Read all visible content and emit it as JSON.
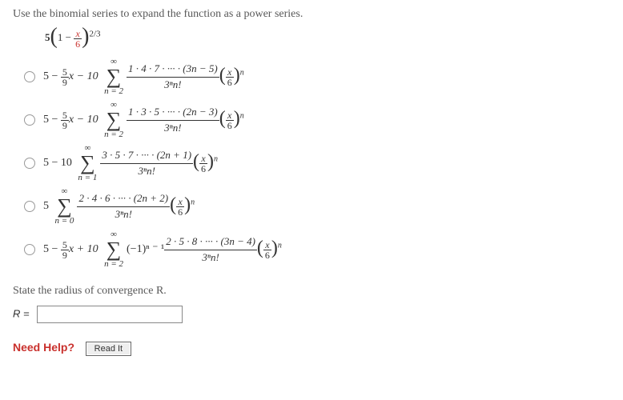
{
  "prompt": "Use the binomial series to expand the function as a power series.",
  "base": {
    "coef": "5",
    "one": "1",
    "xnum": "x",
    "xden": "6",
    "exp": "2/3"
  },
  "choices": [
    {
      "prefix": "5 − ",
      "prefrac_num": "5",
      "prefrac_den": "9",
      "prefix2": "x − 10 ",
      "sum_top": "∞",
      "sum_bot": "n = 2",
      "num": "1 · 4 · 7 · ··· · (3n − 5)",
      "den": "3ⁿn!",
      "term_num": "x",
      "term_den": "6",
      "term_exp": "n"
    },
    {
      "prefix": "5 − ",
      "prefrac_num": "5",
      "prefrac_den": "9",
      "prefix2": "x − 10 ",
      "sum_top": "∞",
      "sum_bot": "n = 2",
      "num": "1 · 3 · 5 · ··· · (2n − 3)",
      "den": "3ⁿn!",
      "term_num": "x",
      "term_den": "6",
      "term_exp": "n"
    },
    {
      "prefix": "5 − 10 ",
      "prefrac_num": "",
      "prefrac_den": "",
      "prefix2": "",
      "sum_top": "∞",
      "sum_bot": "n = 1",
      "num": "3 · 5 · 7 · ··· · (2n + 1)",
      "den": "3ⁿn!",
      "term_num": "x",
      "term_den": "6",
      "term_exp": "n"
    },
    {
      "prefix": "5 ",
      "prefrac_num": "",
      "prefrac_den": "",
      "prefix2": "",
      "sum_top": "∞",
      "sum_bot": "n = 0",
      "num": "2 · 4 · 6 · ··· · (2n + 2)",
      "den": "3ⁿn!",
      "term_num": "x",
      "term_den": "6",
      "term_exp": "n"
    },
    {
      "prefix": "5 − ",
      "prefrac_num": "5",
      "prefrac_den": "9",
      "prefix2": "x + 10 ",
      "sum_top": "∞",
      "sum_bot": "n = 2",
      "mid": "(−1)ⁿ ⁻ ¹",
      "num": "2 · 5 · 8 · ··· · (3n − 4)",
      "den": "3ⁿn!",
      "term_num": "x",
      "term_den": "6",
      "term_exp": "n"
    }
  ],
  "state_prompt": "State the radius of convergence R.",
  "r_label": "R = ",
  "help": {
    "label": "Need Help?",
    "btn": "Read It"
  }
}
